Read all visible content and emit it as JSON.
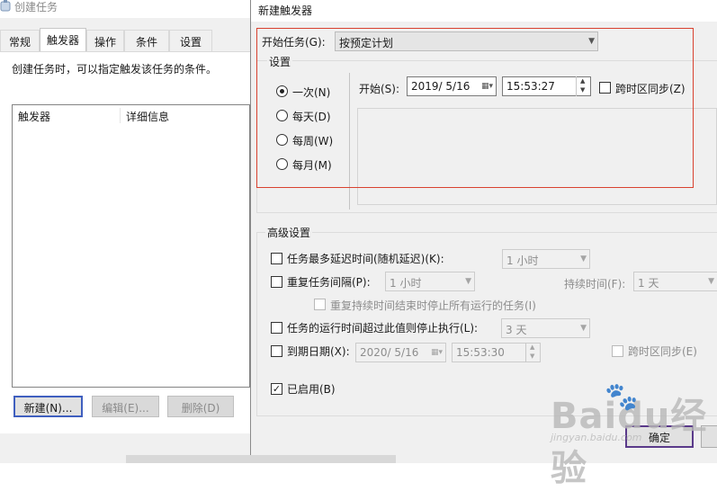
{
  "back_window": {
    "title": "创建任务",
    "tabs": [
      "常规",
      "触发器",
      "操作",
      "条件",
      "设置"
    ],
    "active_tab": "触发器",
    "description": "创建任务时，可以指定触发该任务的条件。",
    "columns": [
      "触发器",
      "详细信息"
    ],
    "buttons": {
      "new": "新建(N)...",
      "edit": "编辑(E)...",
      "delete": "删除(D)"
    }
  },
  "dialog": {
    "title": "新建触发器",
    "begin_task_label": "开始任务(G):",
    "begin_task_value": "按预定计划",
    "settings_legend": "设置",
    "schedule_options": [
      "一次(N)",
      "每天(D)",
      "每周(W)",
      "每月(M)"
    ],
    "schedule_selected": "一次(N)",
    "start_label": "开始(S):",
    "start_date": "2019/ 5/16",
    "start_time": "15:53:27",
    "sync_timezone": "跨时区同步(Z)",
    "advanced_legend": "高级设置",
    "advanced": {
      "delay_label": "任务最多延迟时间(随机延迟)(K):",
      "delay_value": "1 小时",
      "repeat_label": "重复任务间隔(P):",
      "repeat_value": "1 小时",
      "duration_label": "持续时间(F):",
      "duration_value": "1 天",
      "stop_all_label": "重复持续时间结束时停止所有运行的任务(I)",
      "stop_long_label": "任务的运行时间超过此值则停止执行(L):",
      "stop_long_value": "3 天",
      "expire_label": "到期日期(X):",
      "expire_date": "2020/ 5/16",
      "expire_time": "15:53:30",
      "expire_sync": "跨时区同步(E)",
      "enabled_label": "已启用(B)"
    },
    "ok_label": "确定"
  },
  "watermark": {
    "brand": "Baidu经验",
    "url": "jingyan.baidu.com"
  },
  "colors": {
    "highlight": "#d9412f",
    "dialog_bg": "#f0f0f0",
    "primary_border": "#3f5fbf"
  },
  "icons": [
    "task-scheduler-icon",
    "calendar-icon",
    "dropdown-arrow-icon",
    "spin-up-icon",
    "spin-down-icon",
    "checkmark-icon",
    "paw-icon"
  ]
}
